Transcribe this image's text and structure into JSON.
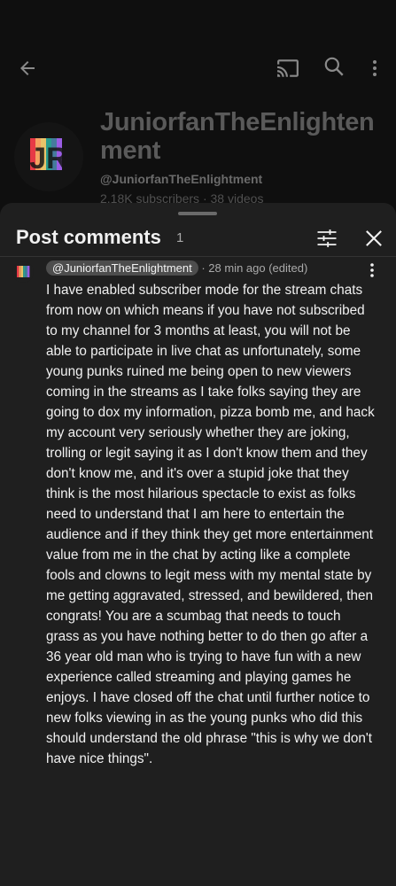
{
  "top_bar": {
    "icons": [
      "back-arrow-icon",
      "cast-icon",
      "search-icon",
      "more-vert-icon"
    ]
  },
  "channel": {
    "title": "JuniorfanTheEnlightenment",
    "handle": "@JuniorfanTheEnlightment",
    "subscribers": "2.18K subscribers",
    "separator": " · ",
    "videos": "38 videos",
    "avatar_text": "JR"
  },
  "comments_sheet": {
    "title": "Post comments",
    "count": "1",
    "icons": [
      "filter-icon",
      "close-icon"
    ]
  },
  "comment": {
    "author_handle": "@JuniorfanTheEnlightment",
    "meta": " · 28 min ago (edited)",
    "text": "I have enabled subscriber mode for the stream chats from now on which means if you have not subscribed to my channel for 3 months at least, you will not be able to participate in live chat as unfortunately, some young punks ruined me being open to new viewers coming in the streams as I take folks saying they are going to dox my information, pizza bomb me, and hack my account very seriously whether they are joking, trolling or legit saying it as I don't know them and they don't know me, and it's over a stupid joke that they think is the most hilarious spectacle to exist as folks need to understand that I am here to entertain the audience and if they think they get more entertainment value from me in the chat by acting like a complete fools and clowns to legit mess with my mental state by me getting aggravated, stressed, and bewildered, then congrats! You are a scumbag that needs to touch grass as you have nothing better to do then go after a 36 year old man who is trying to have fun with a new experience called streaming and playing games he enjoys. I have closed off the chat until further notice to new folks viewing in as the young punks who did this should understand the old phrase \"this is why we don't have nice things\"."
  },
  "colors": {
    "background": "#0f0f0f",
    "sheet": "#1f1f1f",
    "text_primary": "#f1f1f1",
    "text_secondary": "#aaaaaa"
  }
}
